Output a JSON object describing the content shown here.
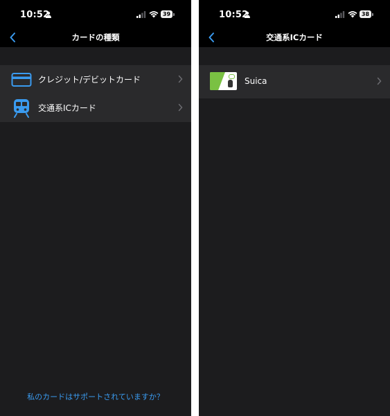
{
  "left_screen": {
    "status": {
      "time": "10:52",
      "battery": "39"
    },
    "nav": {
      "title": "カードの種類"
    },
    "items": [
      {
        "label": "クレジット/デビットカード",
        "icon": "credit-card-icon"
      },
      {
        "label": "交通系ICカード",
        "icon": "train-icon"
      }
    ],
    "footer_link": "私のカードはサポートされていますか？"
  },
  "right_screen": {
    "status": {
      "time": "10:52",
      "battery": "38"
    },
    "nav": {
      "title": "交通系ICカード"
    },
    "items": [
      {
        "label": "Suica",
        "icon": "suica-card-icon"
      }
    ]
  },
  "colors": {
    "background": "#1c1c1e",
    "row": "#2a2a2c",
    "accent": "#3a9bf0",
    "suica_green": "#7ac143"
  }
}
